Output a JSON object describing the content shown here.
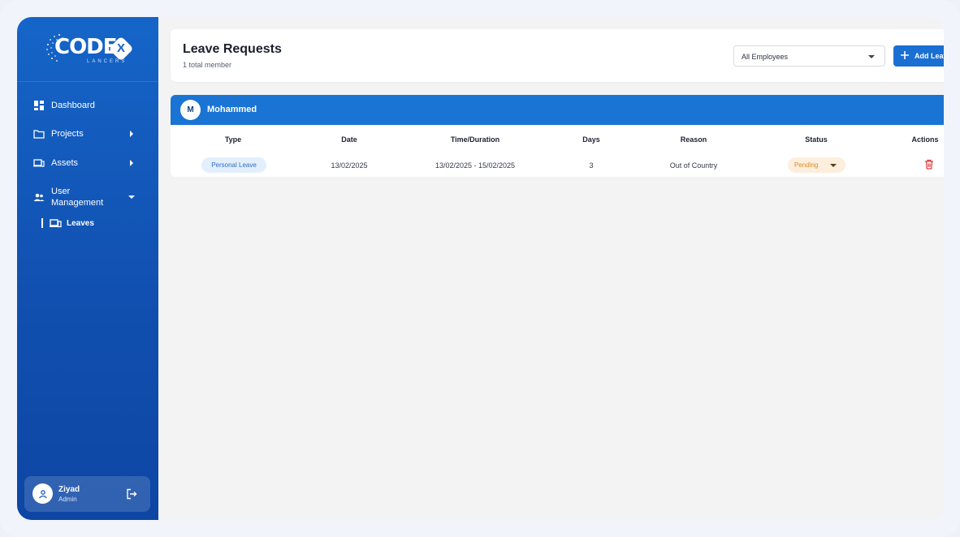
{
  "brand": {
    "logo_name": "CODEX",
    "logo_letters": "CODE",
    "logo_x": "X",
    "logo_sub": "LANCERS",
    "logo_icon": "codex-lancers-logo"
  },
  "sidebar": {
    "items": [
      {
        "label": "Dashboard",
        "icon": "dashboard-icon",
        "has_arrow": false
      },
      {
        "label": "Projects",
        "icon": "folder-icon",
        "has_arrow": true
      },
      {
        "label": "Assets",
        "icon": "devices-icon",
        "has_arrow": true
      },
      {
        "label_line1": "User",
        "label_line2": "Management",
        "icon": "users-icon",
        "expanded": true
      }
    ],
    "sub_items": [
      {
        "label": "Leaves",
        "icon": "devices-icon",
        "active": true
      }
    ]
  },
  "user": {
    "name": "Ziyad",
    "role": "Admin"
  },
  "header": {
    "title": "Leave Requests",
    "subtitle": "1 total member",
    "filter_value": "All Employees",
    "add_button_label": "Add Leave"
  },
  "table": {
    "columns": [
      "Type",
      "Date",
      "Time/Duration",
      "Days",
      "Reason",
      "Status",
      "Actions"
    ],
    "group": {
      "initial": "M",
      "name": "Mohammed",
      "rows": [
        {
          "type": "Personal Leave",
          "date": "13/02/2025",
          "duration": "13/02/2025 - 15/02/2025",
          "days": "3",
          "reason": "Out of Country",
          "status": "Pending"
        }
      ]
    }
  },
  "colors": {
    "primary": "#1a74d4",
    "sidebar": "#1150b0",
    "pending_bg": "#fdeedd",
    "pending_text": "#e08a1e",
    "type_bg": "#e3effd",
    "delete": "#e03a3a"
  }
}
